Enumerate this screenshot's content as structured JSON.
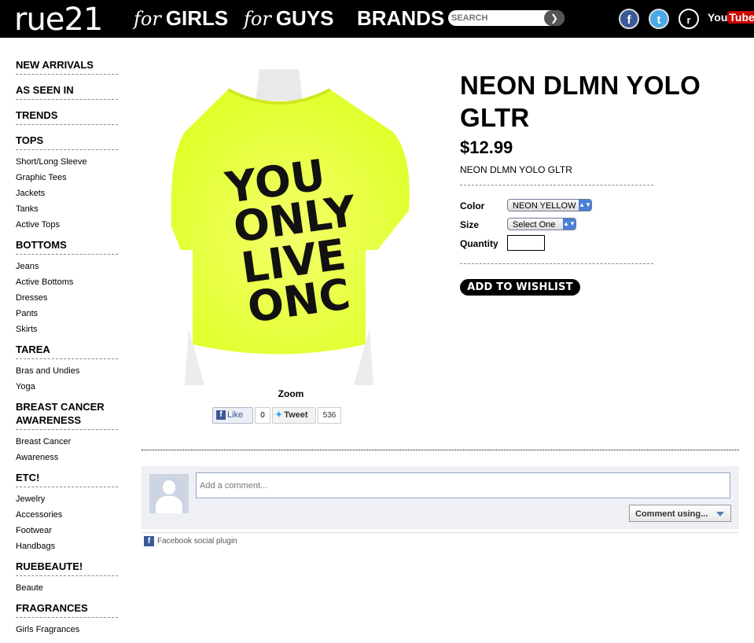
{
  "header": {
    "logo": "rue21",
    "nav": [
      {
        "prefix": "for",
        "label": "GIRLS"
      },
      {
        "prefix": "for",
        "label": "GUYS"
      },
      {
        "prefix": "",
        "label": "BRANDS"
      }
    ],
    "search_placeholder": "SEARCH",
    "social": {
      "facebook": "f",
      "twitter": "t",
      "rue21": "r",
      "youtube_you": "You",
      "youtube_tube": "Tube"
    }
  },
  "sidebar": {
    "new_arrivals": "NEW ARRIVALS",
    "as_seen_in": "AS SEEN IN",
    "trends": "TRENDS",
    "tops": {
      "label": "TOPS",
      "items": [
        "Short/Long Sleeve",
        "Graphic Tees",
        "Jackets",
        "Tanks",
        "Active Tops"
      ]
    },
    "bottoms": {
      "label": "BOTTOMS",
      "items": [
        "Jeans",
        "Active Bottoms",
        "Dresses",
        "Pants",
        "Skirts"
      ]
    },
    "tarea": {
      "label": "TAREA",
      "items": [
        "Bras and Undies",
        "Yoga"
      ]
    },
    "breast_cancer": {
      "label": "BREAST CANCER AWARENESS",
      "items": [
        "Breast Cancer Awareness"
      ]
    },
    "etc": {
      "label": "ETC!",
      "items": [
        "Jewelry",
        "Accessories",
        "Footwear",
        "Handbags"
      ]
    },
    "ruebeaute": {
      "label": "RUEBEAUTE!",
      "items": [
        "Beaute"
      ]
    },
    "fragrances": {
      "label": "FRAGRANCES",
      "items": [
        "Girls Fragrances"
      ]
    }
  },
  "product": {
    "title": "NEON DLMN YOLO GLTR",
    "price": "$12.99",
    "sku": "NEON DLMN YOLO GLTR",
    "color_label": "Color",
    "color_value": "NEON YELLOW",
    "size_label": "Size",
    "size_value": "Select One",
    "quantity_label": "Quantity",
    "wishlist_label": "ADD TO WISHLIST",
    "shirt_text": [
      "YOU",
      "ONLY",
      "LIVE",
      "ONC"
    ],
    "shirt_color": "#e8ff3a",
    "zoom_label": "Zoom"
  },
  "share": {
    "like_label": "Like",
    "like_count": "0",
    "tweet_label": "Tweet",
    "tweet_count": "536"
  },
  "comments": {
    "placeholder": "Add a comment...",
    "comment_using": "Comment using...",
    "plugin_label": "Facebook social plugin"
  }
}
